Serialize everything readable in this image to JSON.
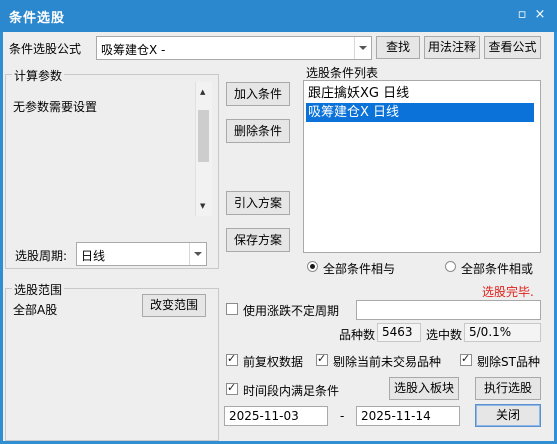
{
  "window": {
    "title": "条件选股",
    "close_glyph": "×"
  },
  "formula": {
    "label": "条件选股公式",
    "value": "吸筹建仓X  -"
  },
  "buttons": {
    "find": "查找",
    "usage": "用法注释",
    "view": "查看公式",
    "add_condition": "加入条件",
    "delete_condition": "删除条件",
    "import_plan": "引入方案",
    "save_plan": "保存方案",
    "change_range": "改变范围",
    "select_to_block": "选股入板块",
    "execute": "执行选股",
    "close": "关闭"
  },
  "params": {
    "legend": "计算参数",
    "message": "无参数需要设置",
    "period_label": "选股周期:",
    "period_value": "日线"
  },
  "conditions": {
    "legend": "选股条件列表",
    "items": [
      "跟庄擒妖XG  日线",
      "吸筹建仓X  日线"
    ],
    "selected_index": 1
  },
  "logic": {
    "and_label": "全部条件相与",
    "or_label": "全部条件相或",
    "selected": "and"
  },
  "status": {
    "text": "选股完毕.",
    "color": "#e0201a"
  },
  "range": {
    "legend": "选股范围",
    "value": "全部A股"
  },
  "options": {
    "use_change_period": {
      "label": "使用涨跌不定周期",
      "checked": false
    },
    "forward_adjust": {
      "label": "前复权数据",
      "checked": true
    },
    "exclude_untraded": {
      "label": "剔除当前未交易品种",
      "checked": true
    },
    "exclude_st": {
      "label": "剔除ST品种",
      "checked": true
    },
    "time_period": {
      "label": "时间段内满足条件",
      "checked": true
    }
  },
  "stats": {
    "count_label": "品种数",
    "count_value": "5463",
    "selected_label": "选中数",
    "selected_value": "5/0.1%"
  },
  "dates": {
    "start": "2025-11-03",
    "separator": "-",
    "end": "2025-11-14"
  }
}
